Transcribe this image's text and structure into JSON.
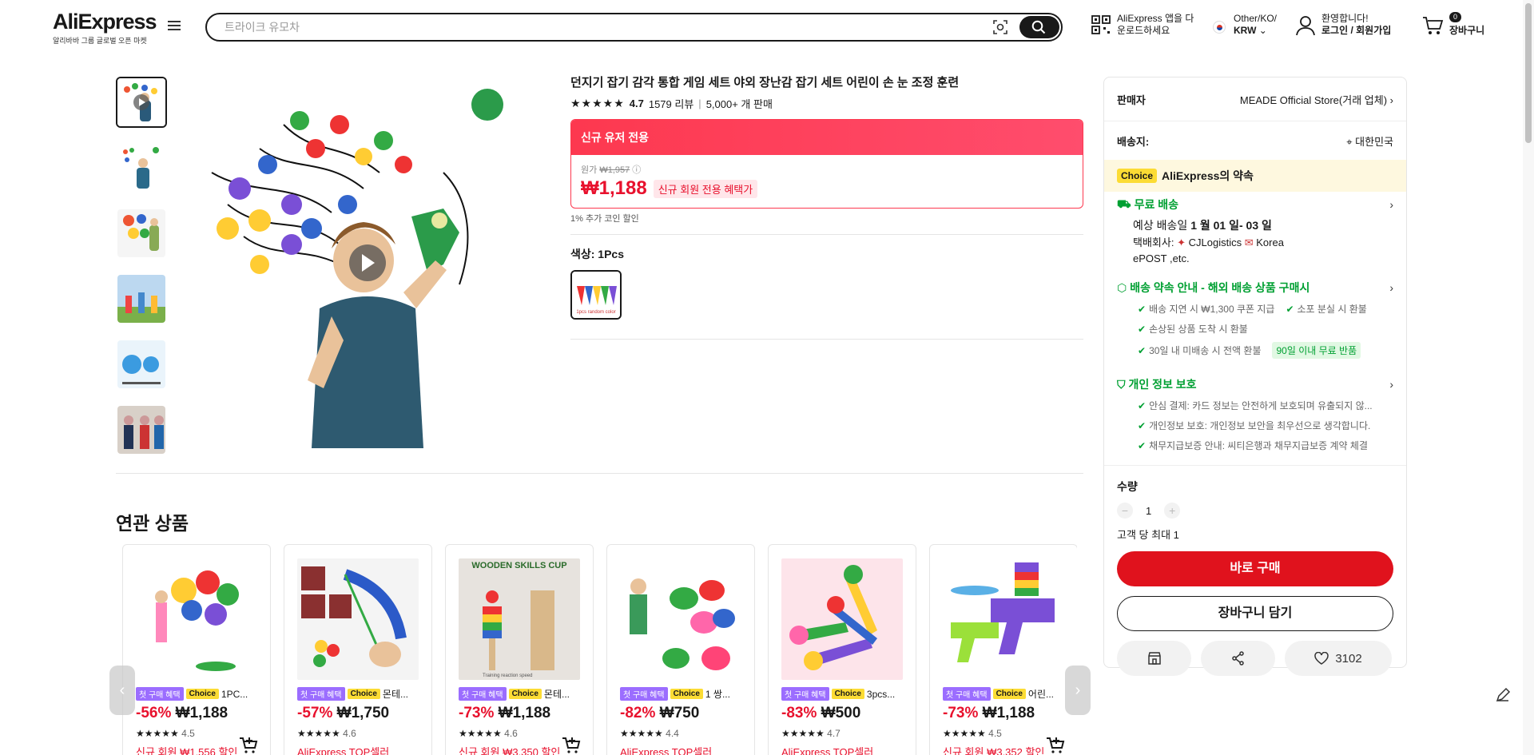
{
  "header": {
    "brand": "AliExpress",
    "tagline": "알리바바 그룹 글로벌 오픈 마켓",
    "search_placeholder": "트라이크 유모차",
    "app_line1": "AliExpress 앱을 다",
    "app_line2": "운로드하세요",
    "region_line1": "Other/KO/",
    "region_line2": "KRW",
    "account_line1": "환영합니다!",
    "account_line2": "로그인 / 회원가입",
    "cart_count": "0",
    "cart_label": "장바구니"
  },
  "product": {
    "title": "던지기 잡기 감각 통합 게임 세트 야외 장난감 잡기 세트 어린이 손 눈 조정 훈련",
    "stars": "★★★★★",
    "rating": "4.7",
    "reviews": "1579 리뷰",
    "sold": "5,000+ 개 판매",
    "promo_header": "신규 유저 전용",
    "orig_label": "원가",
    "orig_price": "₩1,957",
    "price": "₩1,188",
    "price_tag": "신규 회원 전용 혜택가",
    "coin_note": "1% 추가 코인 할인",
    "color_label": "색상: 1Pcs",
    "swatch_text": "1pcs random color"
  },
  "panel": {
    "seller_label": "판매자",
    "seller_value": "MEADE Official Store(거래 업체)",
    "ship_to_label": "배송지:",
    "ship_to_value": "대한민국",
    "choice_badge": "Choice",
    "choice_promise": "AliExpress의 약속",
    "free_ship": "무료 배송",
    "eta_prefix": "예상 배송일",
    "eta_value": "1 월 01 일- 03 일",
    "carrier_label": "택배회사:",
    "carrier_value": "CJLogistics",
    "carrier_value2": "Korea",
    "carrier_value3": "ePOST ,etc.",
    "promise_title": "배송 약속 안내 - 해외 배송 상품 구매시",
    "promise_b1": "배송 지연 시 ₩1,300 쿠폰 지급",
    "promise_b2": "소포 분실 시 환불",
    "promise_b3": "손상된 상품 도착 시 환불",
    "promise_b4": "30일 내 미배송 시 전액 환불",
    "promise_tag": "90일 이내 무료 반품",
    "privacy_title": "개인 정보 보호",
    "privacy_b1": "안심 결제: 카드 정보는 안전하게 보호되며 유출되지 않...",
    "privacy_b2": "개인정보 보호: 개인정보 보안을 최우선으로 생각합니다.",
    "privacy_b3": "채무지급보증 안내: 씨티은행과 채무지급보증 계약 체결",
    "qty_label": "수량",
    "qty_minus": "−",
    "qty_value": "1",
    "qty_plus": "+",
    "max_label": "고객 당 최대 1",
    "buy_now": "바로 구매",
    "add_cart": "장바구니 담기",
    "wish_count": "3102"
  },
  "related": {
    "title": "연관 상품",
    "items": [
      {
        "first": "첫 구매 혜택",
        "choice": "Choice",
        "name": "1PC...",
        "discount": "-56%",
        "price": "₩1,188",
        "stars": "★★★★★",
        "rating": "4.5",
        "extra": "신규 회원 ₩1,556 할인"
      },
      {
        "first": "첫 구매 혜택",
        "choice": "Choice",
        "name": "몬테...",
        "discount": "-57%",
        "price": "₩1,750",
        "stars": "★★★★★",
        "rating": "4.6",
        "extra": "AliExpress TOP셀러"
      },
      {
        "first": "첫 구매 혜택",
        "choice": "Choice",
        "name": "몬테...",
        "discount": "-73%",
        "price": "₩1,188",
        "stars": "★★★★★",
        "rating": "4.6",
        "extra": "신규 회원 ₩3,350 할인",
        "img_text": "WOODEN SKILLS CUP",
        "img_sub": "Training reaction speed"
      },
      {
        "first": "첫 구매 혜택",
        "choice": "Choice",
        "name": "1 쌍...",
        "discount": "-82%",
        "price": "₩750",
        "stars": "★★★★★",
        "rating": "4.4",
        "extra": "AliExpress TOP셀러"
      },
      {
        "first": "첫 구매 혜택",
        "choice": "Choice",
        "name": "3pcs...",
        "discount": "-83%",
        "price": "₩500",
        "stars": "★★★★★",
        "rating": "4.7",
        "extra": "AliExpress TOP셀러"
      },
      {
        "first": "첫 구매 혜택",
        "choice": "Choice",
        "name": "어린...",
        "discount": "-73%",
        "price": "₩1,188",
        "stars": "★★★★★",
        "rating": "4.5",
        "extra": "신규 회원 ₩3,352 할인"
      }
    ]
  },
  "colors": {
    "accent_red": "#e0121d",
    "price_red": "#e8112d",
    "green": "#00a032",
    "choice_yellow": "#fcdc34"
  }
}
